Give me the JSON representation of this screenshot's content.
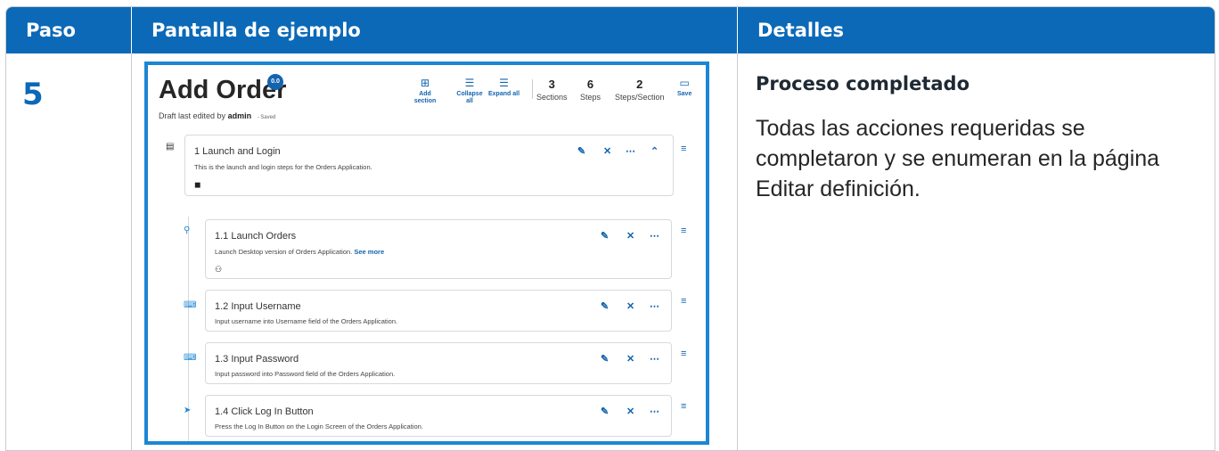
{
  "table": {
    "headers": {
      "step": "Paso",
      "screen": "Pantalla de ejemplo",
      "details": "Detalles"
    },
    "row": {
      "step": "5",
      "details_title": "Proceso completado",
      "details_text": "Todas las acciones requeridas se completaron y se enumeran en la página Editar definición."
    }
  },
  "screenshot": {
    "title": "Add Order",
    "version": "0.0",
    "draft_prefix": "Draft last edited by",
    "draft_user": "admin",
    "saved": "Saved",
    "tools": [
      {
        "icon": "add-section-icon",
        "label": "Add section"
      },
      {
        "icon": "collapse-icon",
        "label": "Collapse all"
      },
      {
        "icon": "expand-icon",
        "label": "Expand all"
      }
    ],
    "stats": [
      {
        "value": "3",
        "label": "Sections"
      },
      {
        "value": "6",
        "label": "Steps"
      },
      {
        "value": "2",
        "label": "Steps/Section"
      }
    ],
    "save_label": "Save",
    "section": {
      "title": "1 Launch and Login",
      "desc": "This is the launch and login steps for the Orders Application."
    },
    "steps": [
      {
        "title": "1.1 Launch Orders",
        "desc": "Launch Desktop version of Orders Application.",
        "more": "See more",
        "icon": "launch-icon"
      },
      {
        "title": "1.2 Input Username",
        "desc": "Input username into Username field of the Orders Application.",
        "icon": "keyboard-icon"
      },
      {
        "title": "1.3 Input Password",
        "desc": "Input password into Password field of the Orders Application.",
        "icon": "keyboard-icon"
      },
      {
        "title": "1.4 Click Log In Button",
        "desc": "Press the Log In Button on the Login Screen of the Orders Application.",
        "icon": "cursor-icon"
      }
    ]
  }
}
